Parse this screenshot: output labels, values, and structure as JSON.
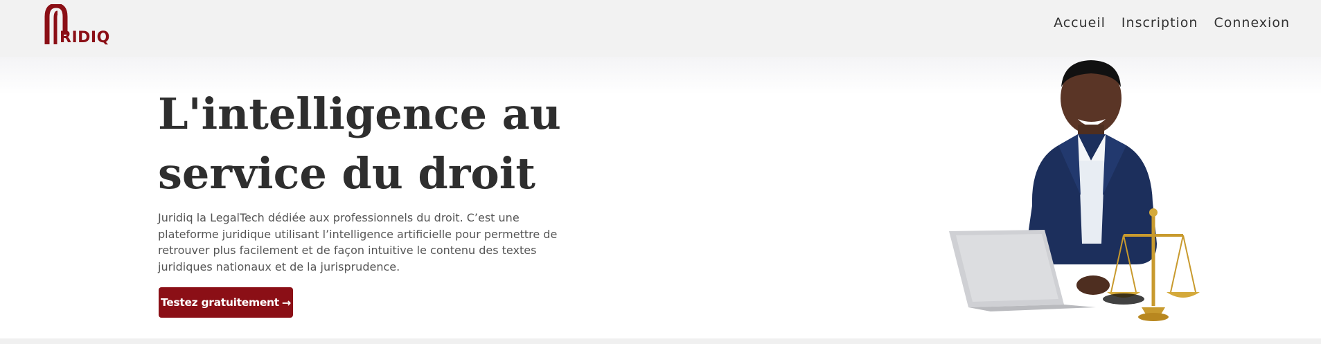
{
  "brand": {
    "logo_text": "RIDIQ",
    "accent_color": "#8b0f16"
  },
  "nav": {
    "items": [
      {
        "label": "Accueil"
      },
      {
        "label": "Inscription"
      },
      {
        "label": "Connexion"
      }
    ]
  },
  "hero": {
    "title": "L'intelligence au service du droit",
    "description": "Juridiq la LegalTech dédiée aux professionnels du droit. C’est une plateforme juridique utilisant l’intelligence artificielle pour permettre de retrouver plus facilement et de façon intuitive le contenu des textes juridiques nationaux et de la jurisprudence.",
    "cta_label": "Testez gratuitement",
    "cta_icon": "arrow-right-icon",
    "illustration": "lawyer-with-laptop-and-scales"
  }
}
